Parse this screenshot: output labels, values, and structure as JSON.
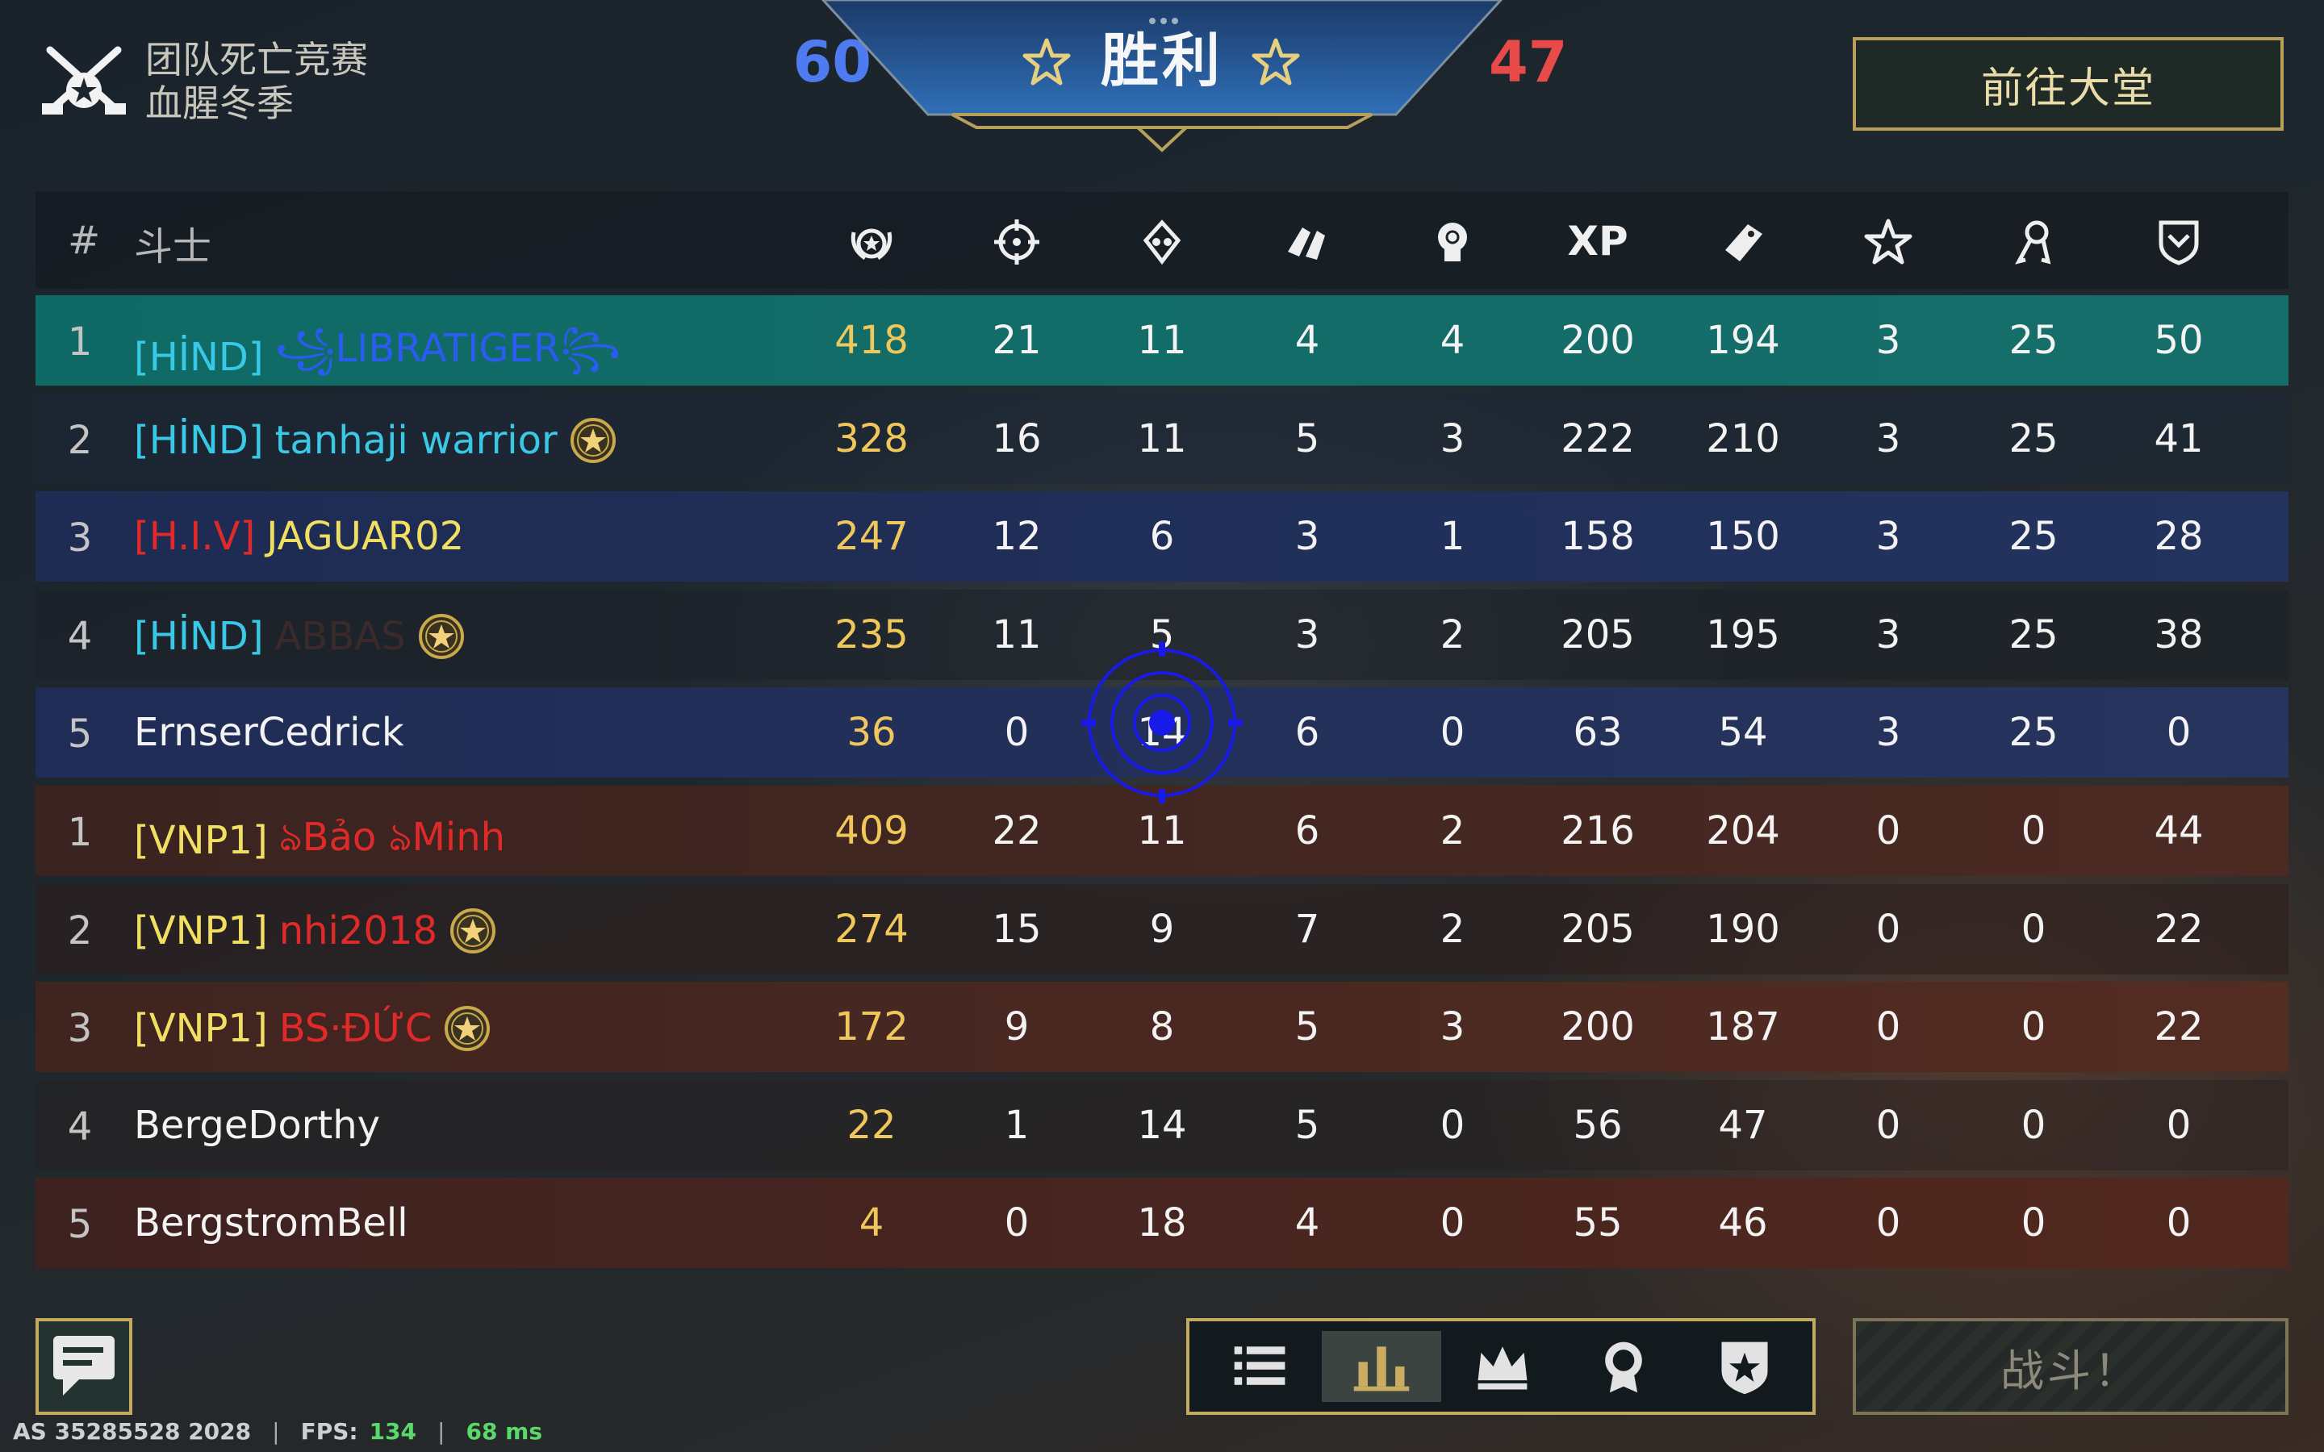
{
  "header": {
    "mode_title": "团队死亡竞赛",
    "map_name": "血腥冬季",
    "score_blue": "60",
    "score_red": "47",
    "result": "胜利",
    "lobby_button": "前往大堂"
  },
  "table": {
    "rank_header": "#",
    "name_header": "斗士",
    "xp_header": "XP",
    "column_icons": [
      "score-icon",
      "crosshair-kills-icon",
      "skull-deaths-icon",
      "assist-hands-icon",
      "headshot-icon",
      "xp",
      "card-icon",
      "star-icon",
      "ribbon-icon",
      "shield-icon"
    ],
    "rows": [
      {
        "rank": "1",
        "tag": "[HİND]",
        "tag_color": "#39c8e6",
        "name": "꧁LIBRATIGER꧂",
        "name_color": "#2a5cf2",
        "medal": false,
        "values": [
          "418",
          "21",
          "11",
          "4",
          "4",
          "200",
          "194",
          "3",
          "25",
          "50"
        ]
      },
      {
        "rank": "2",
        "tag": "[HİND]",
        "tag_color": "#39c8e6",
        "name": "tanhaji warrior",
        "name_color": "#39c8e6",
        "medal": true,
        "values": [
          "328",
          "16",
          "11",
          "5",
          "3",
          "222",
          "210",
          "3",
          "25",
          "41"
        ]
      },
      {
        "rank": "3",
        "tag": "[H.I.V]",
        "tag_color": "#e02a2a",
        "name": "JAGUAR02",
        "name_color": "#f1df62",
        "medal": false,
        "values": [
          "247",
          "12",
          "6",
          "3",
          "1",
          "158",
          "150",
          "3",
          "25",
          "28"
        ]
      },
      {
        "rank": "4",
        "tag": "[HİND]",
        "tag_color": "#39c8e6",
        "name": "ABBAS",
        "name_color": "#3b2a2a",
        "medal": true,
        "values": [
          "235",
          "11",
          "5",
          "3",
          "2",
          "205",
          "195",
          "3",
          "25",
          "38"
        ]
      },
      {
        "rank": "5",
        "tag": "",
        "tag_color": "#ffffff",
        "name": "ErnserCedrick",
        "name_color": "#f3f3f3",
        "medal": false,
        "values": [
          "36",
          "0",
          "14",
          "6",
          "0",
          "63",
          "54",
          "3",
          "25",
          "0"
        ]
      },
      {
        "rank": "1",
        "tag": "[VNP1]",
        "tag_color": "#f1df62",
        "name": "ঌBảo ঌMinh",
        "name_color": "#e02a2a",
        "medal": false,
        "values": [
          "409",
          "22",
          "11",
          "6",
          "2",
          "216",
          "204",
          "0",
          "0",
          "44"
        ]
      },
      {
        "rank": "2",
        "tag": "[VNP1]",
        "tag_color": "#f1df62",
        "name": "nhi2018",
        "name_color": "#e02a2a",
        "medal": true,
        "values": [
          "274",
          "15",
          "9",
          "7",
          "2",
          "205",
          "190",
          "0",
          "0",
          "22"
        ]
      },
      {
        "rank": "3",
        "tag": "[VNP1]",
        "tag_color": "#f1df62",
        "name": "BS·ĐỨC",
        "name_color": "#e02a2a",
        "medal": true,
        "values": [
          "172",
          "9",
          "8",
          "5",
          "3",
          "200",
          "187",
          "0",
          "0",
          "22"
        ]
      },
      {
        "rank": "4",
        "tag": "",
        "tag_color": "#ffffff",
        "name": "BergeDorthy",
        "name_color": "#f3f3f3",
        "medal": false,
        "values": [
          "22",
          "1",
          "14",
          "5",
          "0",
          "56",
          "47",
          "0",
          "0",
          "0"
        ]
      },
      {
        "rank": "5",
        "tag": "",
        "tag_color": "#ffffff",
        "name": "BergstromBell",
        "name_color": "#f3f3f3",
        "medal": false,
        "values": [
          "4",
          "0",
          "18",
          "4",
          "0",
          "55",
          "46",
          "0",
          "0",
          "0"
        ]
      }
    ]
  },
  "bottom": {
    "tabs": [
      "list-icon",
      "bar-chart-icon",
      "crown-icon",
      "medal-icon",
      "shield-star-icon"
    ],
    "active_tab": 1,
    "fight_button": "战斗！"
  },
  "status": {
    "build": "AS 35285528 2028",
    "fps_label": "FPS:",
    "fps_value": "134",
    "ping": "68 ms"
  },
  "colors": {
    "accent_gold": "#c2aa5e",
    "team_blue": "#4f7bf0",
    "team_red": "#e84a4a"
  }
}
